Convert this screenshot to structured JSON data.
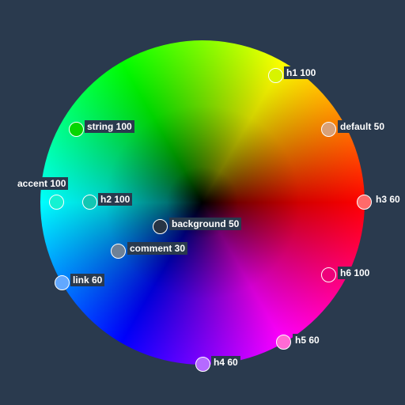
{
  "swatches": [
    {
      "id": "h1",
      "label": "h1 100",
      "color": "#d8f400"
    },
    {
      "id": "default",
      "label": "default 50",
      "color": "#d9a177"
    },
    {
      "id": "string",
      "label": "string 100",
      "color": "#07d600"
    },
    {
      "id": "accent",
      "label": "accent 100",
      "color": "#15f2d2"
    },
    {
      "id": "h2",
      "label": "h2 100",
      "color": "#12c7b3"
    },
    {
      "id": "h3",
      "label": "h3 60",
      "color": "#ff6a6a"
    },
    {
      "id": "background",
      "label": "background 50",
      "color": "#273444"
    },
    {
      "id": "comment",
      "label": "comment 30",
      "color": "#6d8197"
    },
    {
      "id": "h6",
      "label": "h6 100",
      "color": "#ee007a"
    },
    {
      "id": "link",
      "label": "link 60",
      "color": "#62a8ff"
    },
    {
      "id": "h5",
      "label": "h5 60",
      "color": "#ff6ad4"
    },
    {
      "id": "h4",
      "label": "h4 60",
      "color": "#b56aff"
    }
  ]
}
